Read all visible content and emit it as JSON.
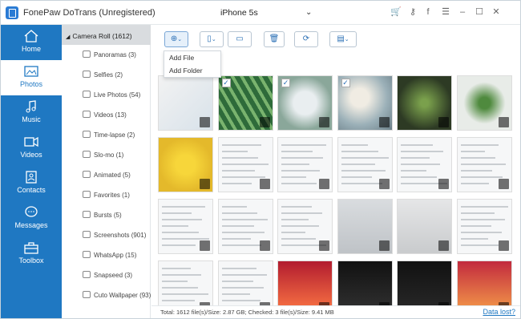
{
  "app": {
    "title": "FonePaw DoTrans (Unregistered)",
    "device": "iPhone 5s",
    "brand_color": "#1f78c2"
  },
  "window_controls": [
    "cart-icon",
    "key-icon",
    "facebook-icon",
    "menu-icon",
    "minimize-icon",
    "maximize-icon",
    "close-icon"
  ],
  "nav": [
    {
      "label": "Home",
      "icon": "home-icon"
    },
    {
      "label": "Photos",
      "icon": "photos-icon",
      "active": true
    },
    {
      "label": "Music",
      "icon": "music-icon"
    },
    {
      "label": "Videos",
      "icon": "videos-icon"
    },
    {
      "label": "Contacts",
      "icon": "contacts-icon"
    },
    {
      "label": "Messages",
      "icon": "messages-icon"
    },
    {
      "label": "Toolbox",
      "icon": "toolbox-icon"
    }
  ],
  "tree": {
    "root": "Camera Roll (1612)",
    "items": [
      "Panoramas (3)",
      "Selfies (2)",
      "Live Photos (54)",
      "Videos (13)",
      "Time-lapse (2)",
      "Slo-mo (1)",
      "Animated (5)",
      "Favorites (1)",
      "Bursts (5)",
      "Screenshots (901)",
      "WhatsApp (15)",
      "Snapseed (3)",
      "Cuto Wallpaper (93)"
    ]
  },
  "toolbar": {
    "add_menu": [
      "Add File",
      "Add Folder"
    ]
  },
  "status": {
    "text": "Total: 1612 file(s)/Size: 2.87 GB; Checked: 3 file(s)/Size: 9.41 MB",
    "data_lost": "Data lost?"
  },
  "thumbs_checked": [
    1,
    2,
    3
  ]
}
